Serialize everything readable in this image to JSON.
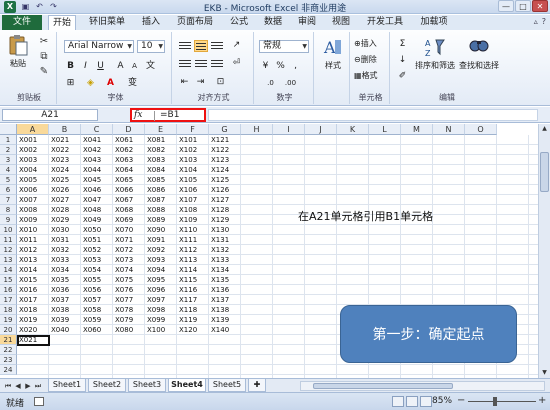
{
  "window": {
    "title": "EKB - Microsoft Excel 非商业用途",
    "logo": "X",
    "buttons": [
      "—",
      "□",
      "✕"
    ]
  },
  "qat_icons": [
    "save-icon",
    "undo-icon",
    "redo-icon"
  ],
  "tabs": {
    "file": "文件",
    "items": [
      "开始",
      "钚旧菜单",
      "插入",
      "页面布局",
      "公式",
      "数据",
      "审阅",
      "视图",
      "开发工具",
      "加载项"
    ],
    "active_index": 0,
    "right_icons": [
      "help-icon",
      "minimize-ribbon-icon"
    ]
  },
  "ribbon": {
    "clipboard": {
      "label": "剪贴板",
      "paste": "粘贴"
    },
    "font": {
      "label": "字体",
      "family": "Arial Narrow",
      "size": "10",
      "bold": "B",
      "italic": "I",
      "underline": "U"
    },
    "alignment": {
      "label": "对齐方式"
    },
    "number": {
      "label": "数字",
      "format": "常规",
      "percent": "%",
      "comma": ",",
      "currency": "¥"
    },
    "styles": {
      "label": "样式"
    },
    "cells": {
      "label": "单元格",
      "insert": "插入",
      "delete": "删除",
      "format": "格式"
    },
    "editing": {
      "label": "编辑",
      "sigma": "Σ",
      "sort_filter": "排序和筛选",
      "find_select": "查找和选择"
    }
  },
  "formula_bar": {
    "name_box": "A21",
    "fx": "fx",
    "formula": "=B1"
  },
  "columns": [
    "A",
    "B",
    "C",
    "D",
    "E",
    "F",
    "G",
    "H",
    "I",
    "J",
    "K",
    "L",
    "M",
    "N",
    "O"
  ],
  "active_column": "A",
  "rows": [
    "1",
    "2",
    "3",
    "4",
    "5",
    "6",
    "7",
    "8",
    "9",
    "10",
    "11",
    "12",
    "13",
    "14",
    "15",
    "16",
    "17",
    "18",
    "19",
    "20",
    "21",
    "22",
    "23",
    "24"
  ],
  "active_row": "21",
  "table": [
    [
      "X001",
      "X021",
      "X041",
      "X061",
      "X081",
      "X101",
      "X121"
    ],
    [
      "X002",
      "X022",
      "X042",
      "X062",
      "X082",
      "X102",
      "X122"
    ],
    [
      "X003",
      "X023",
      "X043",
      "X063",
      "X083",
      "X103",
      "X123"
    ],
    [
      "X004",
      "X024",
      "X044",
      "X064",
      "X084",
      "X104",
      "X124"
    ],
    [
      "X005",
      "X025",
      "X045",
      "X065",
      "X085",
      "X105",
      "X125"
    ],
    [
      "X006",
      "X026",
      "X046",
      "X066",
      "X086",
      "X106",
      "X126"
    ],
    [
      "X007",
      "X027",
      "X047",
      "X067",
      "X087",
      "X107",
      "X127"
    ],
    [
      "X008",
      "X028",
      "X048",
      "X068",
      "X088",
      "X108",
      "X128"
    ],
    [
      "X009",
      "X029",
      "X049",
      "X069",
      "X089",
      "X109",
      "X129"
    ],
    [
      "X010",
      "X030",
      "X050",
      "X070",
      "X090",
      "X110",
      "X130"
    ],
    [
      "X011",
      "X031",
      "X051",
      "X071",
      "X091",
      "X111",
      "X131"
    ],
    [
      "X012",
      "X032",
      "X052",
      "X072",
      "X092",
      "X112",
      "X132"
    ],
    [
      "X013",
      "X033",
      "X053",
      "X073",
      "X093",
      "X113",
      "X133"
    ],
    [
      "X014",
      "X034",
      "X054",
      "X074",
      "X094",
      "X114",
      "X134"
    ],
    [
      "X015",
      "X035",
      "X055",
      "X075",
      "X095",
      "X115",
      "X135"
    ],
    [
      "X016",
      "X036",
      "X056",
      "X076",
      "X096",
      "X116",
      "X136"
    ],
    [
      "X017",
      "X037",
      "X057",
      "X077",
      "X097",
      "X117",
      "X137"
    ],
    [
      "X018",
      "X038",
      "X058",
      "X078",
      "X098",
      "X118",
      "X138"
    ],
    [
      "X019",
      "X039",
      "X059",
      "X079",
      "X099",
      "X119",
      "X139"
    ],
    [
      "X020",
      "X040",
      "X060",
      "X080",
      "X100",
      "X120",
      "X140"
    ],
    [
      "X021",
      "",
      "",
      "",
      "",
      "",
      ""
    ]
  ],
  "annotation": "在A21单元格引用B1单元格",
  "callout": "第一步：确定起点",
  "sheets": [
    "Sheet1",
    "Sheet2",
    "Sheet3",
    "Sheet4",
    "Sheet5"
  ],
  "active_sheet": "Sheet4",
  "status": {
    "mode": "就绪",
    "zoom": "85%",
    "zoom_minus": "−",
    "zoom_plus": "+"
  }
}
